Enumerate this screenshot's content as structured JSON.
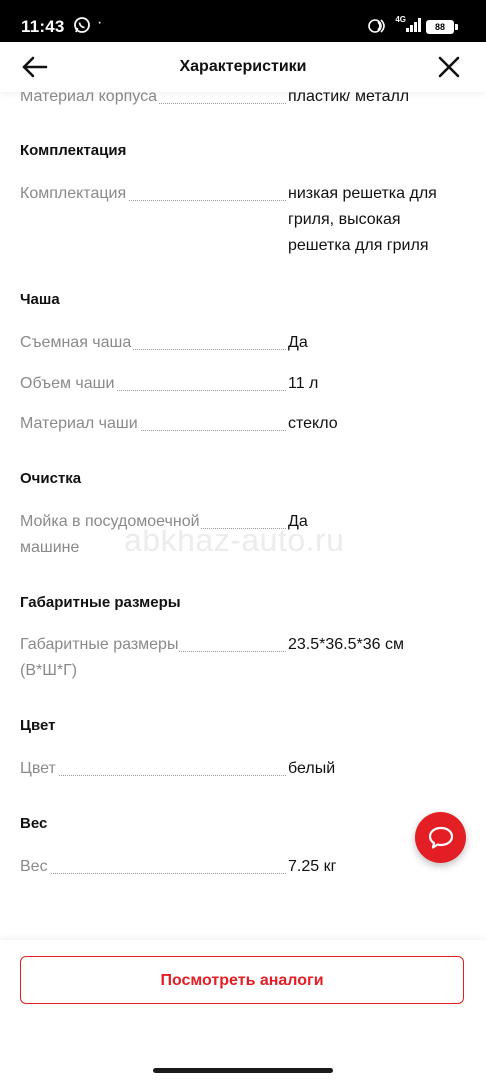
{
  "status_bar": {
    "time": "11:43",
    "dot": "·",
    "network": "4G",
    "battery": "88"
  },
  "header": {
    "title": "Характеристики"
  },
  "sections": {
    "body_material": {
      "label": "Материал корпуса",
      "value": "пластик/ металл"
    },
    "kit": {
      "title": "Комплектация",
      "label": "Комплектация",
      "value": "низкая решетка для гриля, высокая решетка для гриля"
    },
    "bowl": {
      "title": "Чаша",
      "removable_label": "Съемная чаша",
      "removable_value": "Да",
      "volume_label": "Объем чаши",
      "volume_value": "11 л",
      "material_label": "Материал чаши",
      "material_value": "стекло"
    },
    "cleaning": {
      "title": "Очистка",
      "dishwasher_label": "Мойка в посудомоечной машине",
      "dishwasher_value": "Да"
    },
    "dimensions": {
      "title": "Габаритные размеры",
      "label": "Габаритные размеры (В*Ш*Г)",
      "value": "23.5*36.5*36 см"
    },
    "color": {
      "title": "Цвет",
      "label": "Цвет",
      "value": "белый"
    },
    "weight": {
      "title": "Вес",
      "label": "Вес",
      "value": "7.25 кг"
    }
  },
  "watermark": "abkhaz-auto.ru",
  "bottom": {
    "analogs_label": "Посмотреть аналоги"
  },
  "colors": {
    "accent": "#e31e24",
    "label": "#8a8a8a",
    "text": "#111111"
  }
}
